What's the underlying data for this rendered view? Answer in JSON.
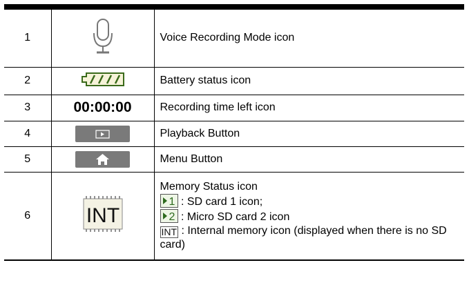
{
  "rows": [
    {
      "num": "1",
      "desc": "Voice Recording Mode icon",
      "icon": "microphone-icon"
    },
    {
      "num": "2",
      "desc": "Battery status icon",
      "icon": "battery-icon"
    },
    {
      "num": "3",
      "time": "00:00:00",
      "desc": "Recording time left icon"
    },
    {
      "num": "4",
      "desc": "Playback Button",
      "icon": "play-icon"
    },
    {
      "num": "5",
      "desc": "Menu Button",
      "icon": "home-icon"
    },
    {
      "num": "6",
      "big_icon_text": "INT",
      "title": "Memory Status icon",
      "sd1_num": "1",
      "sd1_text": ": SD card 1 icon;",
      "sd2_num": "2",
      "sd2_text": ": Micro SD card 2 icon",
      "int_label": "INT",
      "int_text": ": Internal memory icon (displayed when there is no SD card)"
    }
  ],
  "colors": {
    "button_gray": "#7a7a7a",
    "battery_green": "#3a6a1a",
    "sd_green": "#2d6a1e"
  }
}
